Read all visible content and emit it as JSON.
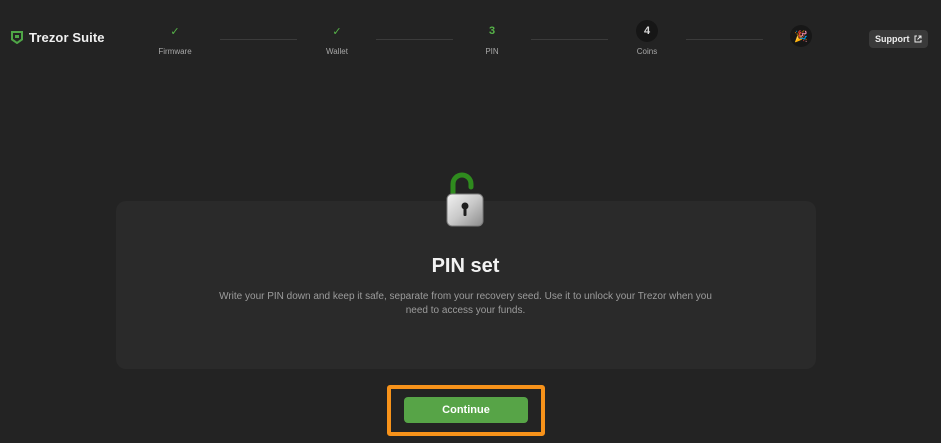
{
  "app": {
    "title": "Trezor Suite"
  },
  "steps": [
    {
      "label": "Firmware",
      "state": "done",
      "marker": "✓"
    },
    {
      "label": "Wallet",
      "state": "done",
      "marker": "✓"
    },
    {
      "label": "PIN",
      "state": "current",
      "marker": "3"
    },
    {
      "label": "Coins",
      "state": "todo",
      "marker": "4"
    }
  ],
  "finish_marker": "🎉",
  "support": {
    "label": "Support"
  },
  "main": {
    "title": "PIN set",
    "description": "Write your PIN down and keep it safe, separate from your recovery seed. Use it to unlock your Trezor when you need to access your funds."
  },
  "continue_button": {
    "label": "Continue"
  },
  "colors": {
    "background": "#232323",
    "card": "#2a2a2a",
    "accent_green": "#57a447",
    "highlight_orange": "#f7921a"
  },
  "icons": {
    "logo": "trezor-shield-icon",
    "lock": "open-padlock-icon",
    "external": "external-link-icon",
    "check": "checkmark-icon",
    "party": "party-popper-icon"
  }
}
